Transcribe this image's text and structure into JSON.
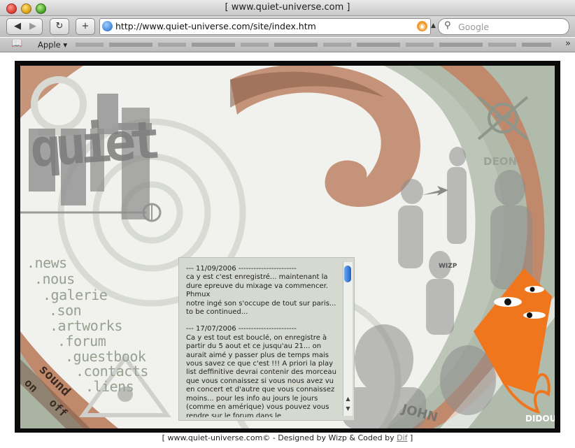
{
  "window": {
    "title": "[ www.quiet-universe.com ]"
  },
  "toolbar": {
    "back_icon": "back-arrow",
    "forward_icon": "forward-arrow",
    "reload_icon": "reload",
    "add_icon": "plus",
    "url": "http://www.quiet-universe.com/site/index.htm",
    "search_placeholder": "Google"
  },
  "bookmarks": {
    "apple_label": "Apple ▾",
    "more_label": "»"
  },
  "site": {
    "logo_text": "quiet",
    "sound_label": "sound",
    "on_label": "on",
    "off_label": "off",
    "decor_labels": [
      "DEON",
      "JOHN",
      "DIDOU",
      "WIZP"
    ],
    "menu": [
      ".news",
      ".nous",
      ".galerie",
      ".son",
      ".artworks",
      ".forum",
      ".guestbook",
      ".contacts",
      ".liens"
    ],
    "news": [
      {
        "header": "--- 11/09/2006 -----------------------",
        "text": "ca y est c'est enregistré... maintenant la dure epreuve du mixage va commencer.\nPhmux\nnotre ingé son s'occupe de tout sur paris... to be continued..."
      },
      {
        "header": "--- 17/07/2006 -----------------------",
        "text": "Ca y est tout est bouclé, on enregistre à partir du 5 aout et ce jusqu'au 21... on aurait aimé y passer plus de temps mais vous savez ce que c'est !!! A priori la play list deffinitive devrai contenir des morceau que vous connaissez si vous nous avez vu en concert et d'autre que vous connaissez moins... pour les info au jours le jours (comme en amérique) vous pouvez vous rendre sur le forum dans le"
      }
    ]
  },
  "footer": {
    "prefix": "[ www.quiet-universe.com© - Designed by Wizp & Coded by ",
    "link": "Dif",
    "suffix": " ]"
  },
  "colors": {
    "accent_copper": "#c08a6c",
    "accent_sage": "#a9b5a3",
    "menu_text": "#97a18f",
    "orange": "#f0761e"
  }
}
